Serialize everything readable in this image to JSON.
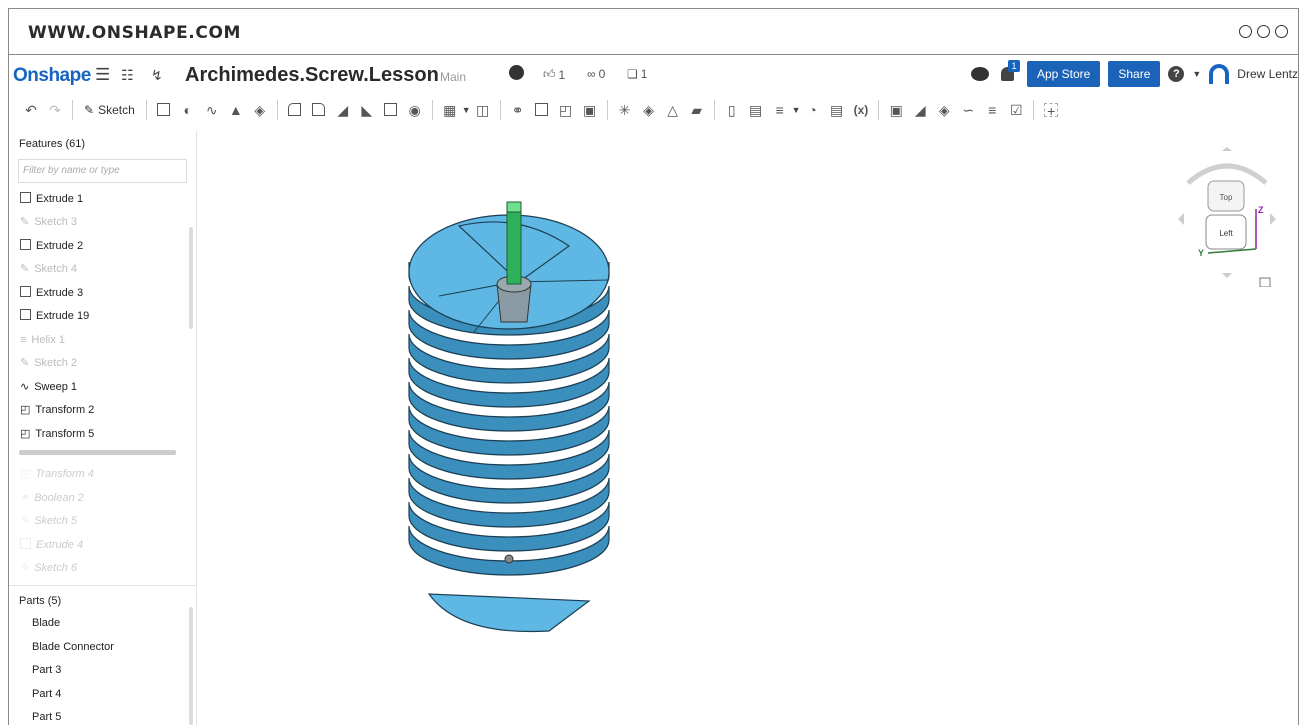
{
  "browser": {
    "url": "WWW.ONSHAPE.COM"
  },
  "appbar": {
    "logo": "Onshape",
    "doc_title": "Archimedes.Screw.Lesson",
    "branch": "Main",
    "likes": "1",
    "links": "0",
    "copies": "1",
    "notifications": "1",
    "app_store": "App Store",
    "share": "Share",
    "user": "Drew Lentz"
  },
  "toolbar": {
    "sketch_label": "Sketch"
  },
  "features": {
    "title": "Features (61)",
    "filter_placeholder": "Filter by name or type",
    "items": [
      {
        "label": "Extrude 1",
        "state": "active",
        "icon": "extrude-icon"
      },
      {
        "label": "Sketch 3",
        "state": "dim",
        "icon": "sketch-icon"
      },
      {
        "label": "Extrude 2",
        "state": "active",
        "icon": "extrude-icon"
      },
      {
        "label": "Sketch 4",
        "state": "dim",
        "icon": "sketch-icon"
      },
      {
        "label": "Extrude 3",
        "state": "active",
        "icon": "extrude-icon"
      },
      {
        "label": "Extrude 19",
        "state": "active",
        "icon": "extrude-icon"
      },
      {
        "label": "Helix 1",
        "state": "dim",
        "icon": "helix-icon"
      },
      {
        "label": "Sketch 2",
        "state": "dim",
        "icon": "sketch-icon"
      },
      {
        "label": "Sweep 1",
        "state": "active",
        "icon": "sweep-icon"
      },
      {
        "label": "Transform 2",
        "state": "active",
        "icon": "transform-icon"
      },
      {
        "label": "Transform 5",
        "state": "active",
        "icon": "transform-icon"
      }
    ],
    "rolled_back": [
      {
        "label": "Transform 4",
        "icon": "transform-icon"
      },
      {
        "label": "Boolean 2",
        "icon": "boolean-icon"
      },
      {
        "label": "Sketch 5",
        "icon": "sketch-icon"
      },
      {
        "label": "Extrude 4",
        "icon": "extrude-icon"
      },
      {
        "label": "Sketch 6",
        "icon": "sketch-icon"
      }
    ]
  },
  "parts": {
    "title": "Parts (5)",
    "items": [
      "Blade",
      "Blade Connector",
      "Part 3",
      "Part 4",
      "Part 5"
    ]
  },
  "viewcube": {
    "top": "Top",
    "left": "Left",
    "axis_z": "Z",
    "axis_y": "Y"
  },
  "colors": {
    "brand": "#1565c0",
    "model": "#5fb8e3",
    "model_dark": "#3b8fbd",
    "shaft": "#2fb05a"
  }
}
